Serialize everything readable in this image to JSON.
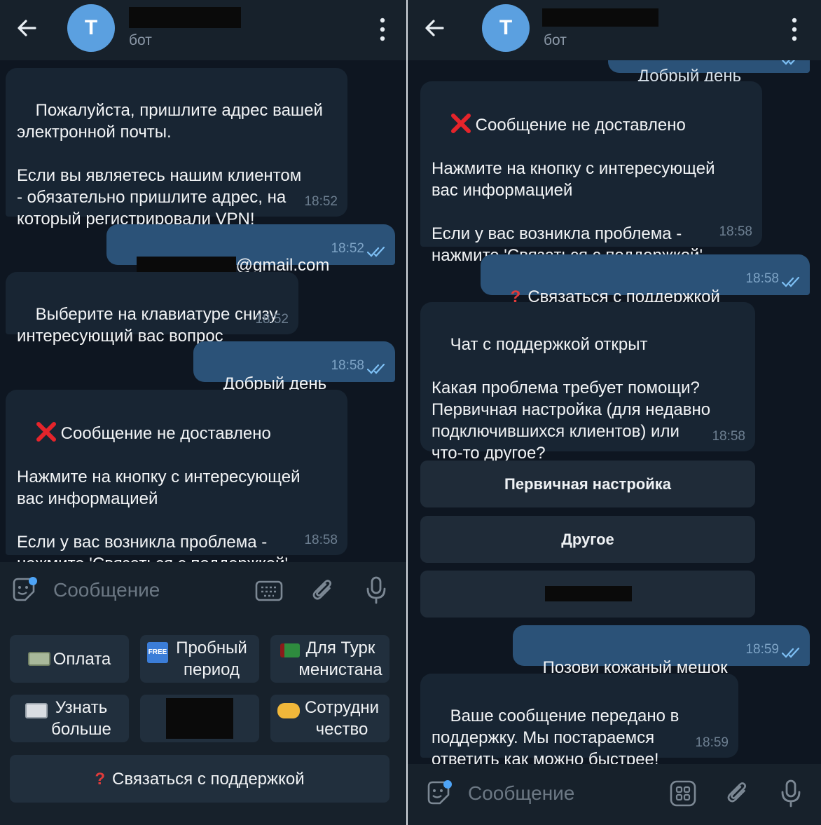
{
  "left": {
    "header": {
      "avatar_letter": "T",
      "subtitle": "бот"
    },
    "messages": [
      {
        "type": "in",
        "text": "Пожалуйста, пришлите адрес вашей\nэлектронной почты.\n\nЕсли вы являетесь нашим клиентом\n- обязательно пришлите адрес, на\nкоторый регистрировали VPN!",
        "time": "18:52"
      },
      {
        "type": "out",
        "text": "@gmail.com",
        "time": "18:52"
      },
      {
        "type": "in",
        "text": "Выберите на клавиатуре снизу\nинтересующий вас вопрос",
        "time": "18:52"
      },
      {
        "type": "out",
        "text": "Добрый день",
        "time": "18:58"
      },
      {
        "type": "in",
        "line1": "Сообщение не доставлено",
        "text": "Нажмите на кнопку с интересующей\nвас информацией\n\nЕсли у вас возникла проблема -\nнажмите 'Связаться с поддержкой'",
        "time": "18:58"
      }
    ],
    "input": {
      "placeholder": "Сообщение"
    },
    "keyboard": {
      "row1": [
        "Оплата",
        "Пробный\nпериод",
        "Для Турк\nменистана"
      ],
      "row2": [
        "Узнать\nбольше",
        "",
        "Сотрудни\nчество"
      ],
      "support": "Связаться с поддержкой",
      "free_badge": "FREE"
    }
  },
  "right": {
    "header": {
      "avatar_letter": "T",
      "subtitle": "бот"
    },
    "messages": [
      {
        "type": "out",
        "text": "Добрый день",
        "time": "18:58"
      },
      {
        "type": "in",
        "line1": "Сообщение не доставлено",
        "text": "Нажмите на кнопку с интересующей\nвас информацией\n\nЕсли у вас возникла проблема -\nнажмите 'Связаться с поддержкой'",
        "time": "18:58"
      },
      {
        "type": "out",
        "text": "Связаться с поддержкой",
        "time": "18:58"
      },
      {
        "type": "in",
        "text": "Чат с поддержкой открыт\n\nКакая проблема требует помощи?\nПервичная настройка (для недавно\nподключившихся клиентов) или\nчто-то другое?",
        "time": "18:58"
      },
      {
        "type": "out",
        "text": "Позови кожаный мешок",
        "time": "18:59"
      },
      {
        "type": "in",
        "text": "Ваше сообщение передано в\nподдержку. Мы постараемся\nответить как можно быстрее!",
        "time": "18:59"
      }
    ],
    "inline_buttons": [
      "Первичная настройка",
      "Другое",
      ""
    ],
    "input": {
      "placeholder": "Сообщение"
    }
  },
  "colors": {
    "background": "#0e1621",
    "header": "#17212b",
    "incoming_bubble": "#182533",
    "outgoing_bubble": "#2b5278",
    "avatar": "#5ba0e0",
    "accent": "#4ea4f6",
    "error_red": "#e03b3b"
  }
}
